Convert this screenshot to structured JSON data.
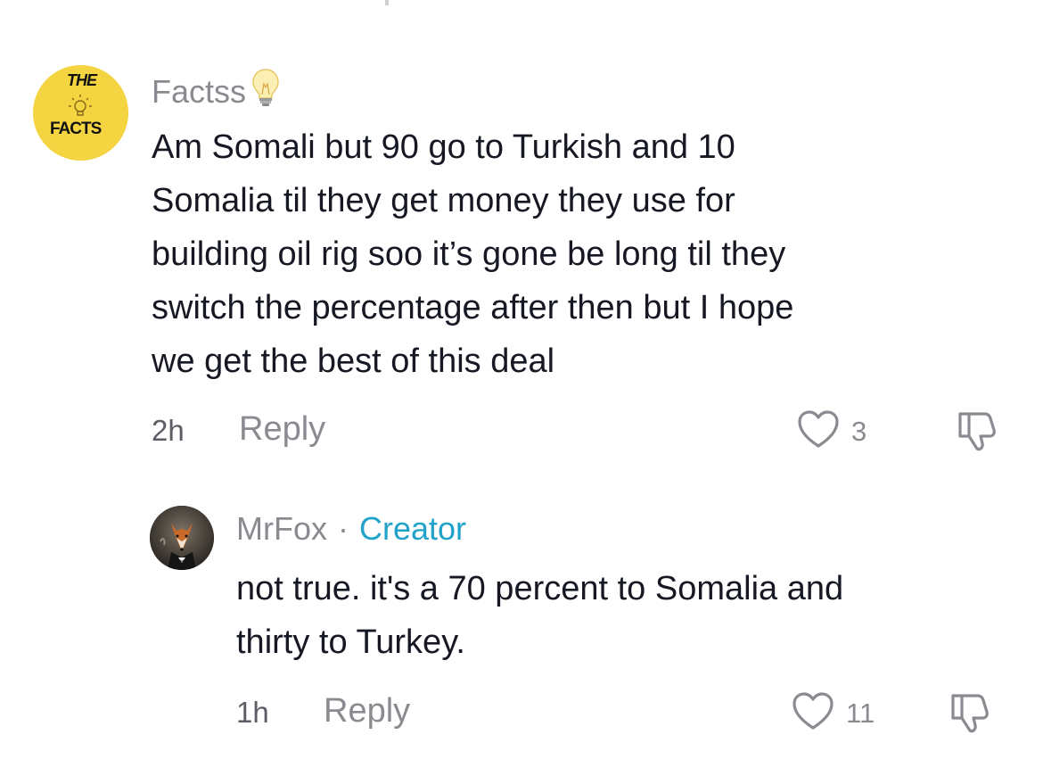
{
  "comments": [
    {
      "username": "Factss",
      "username_emoji": "💡",
      "avatar": {
        "line1": "THE",
        "line2": "FACTS",
        "bg": "#f5d442"
      },
      "text_lines": [
        "Am Somali but 90 go to Turkish and 10",
        "Somalia til they get money they use for",
        "building oil rig soo it’s gone be long til they",
        "switch the percentage after then but I hope",
        "we get the best of this deal"
      ],
      "time": "2h",
      "reply_label": "Reply",
      "likes": "3"
    },
    {
      "username": "MrFox",
      "separator": "·",
      "badge": "Creator",
      "text_lines": [
        "not true. it's a 70 percent to Somalia and",
        "thirty to Turkey."
      ],
      "time": "1h",
      "reply_label": "Reply",
      "likes": "11"
    }
  ],
  "colors": {
    "text": "#161823",
    "muted": "#8a8b91",
    "creator": "#20a2c9"
  }
}
